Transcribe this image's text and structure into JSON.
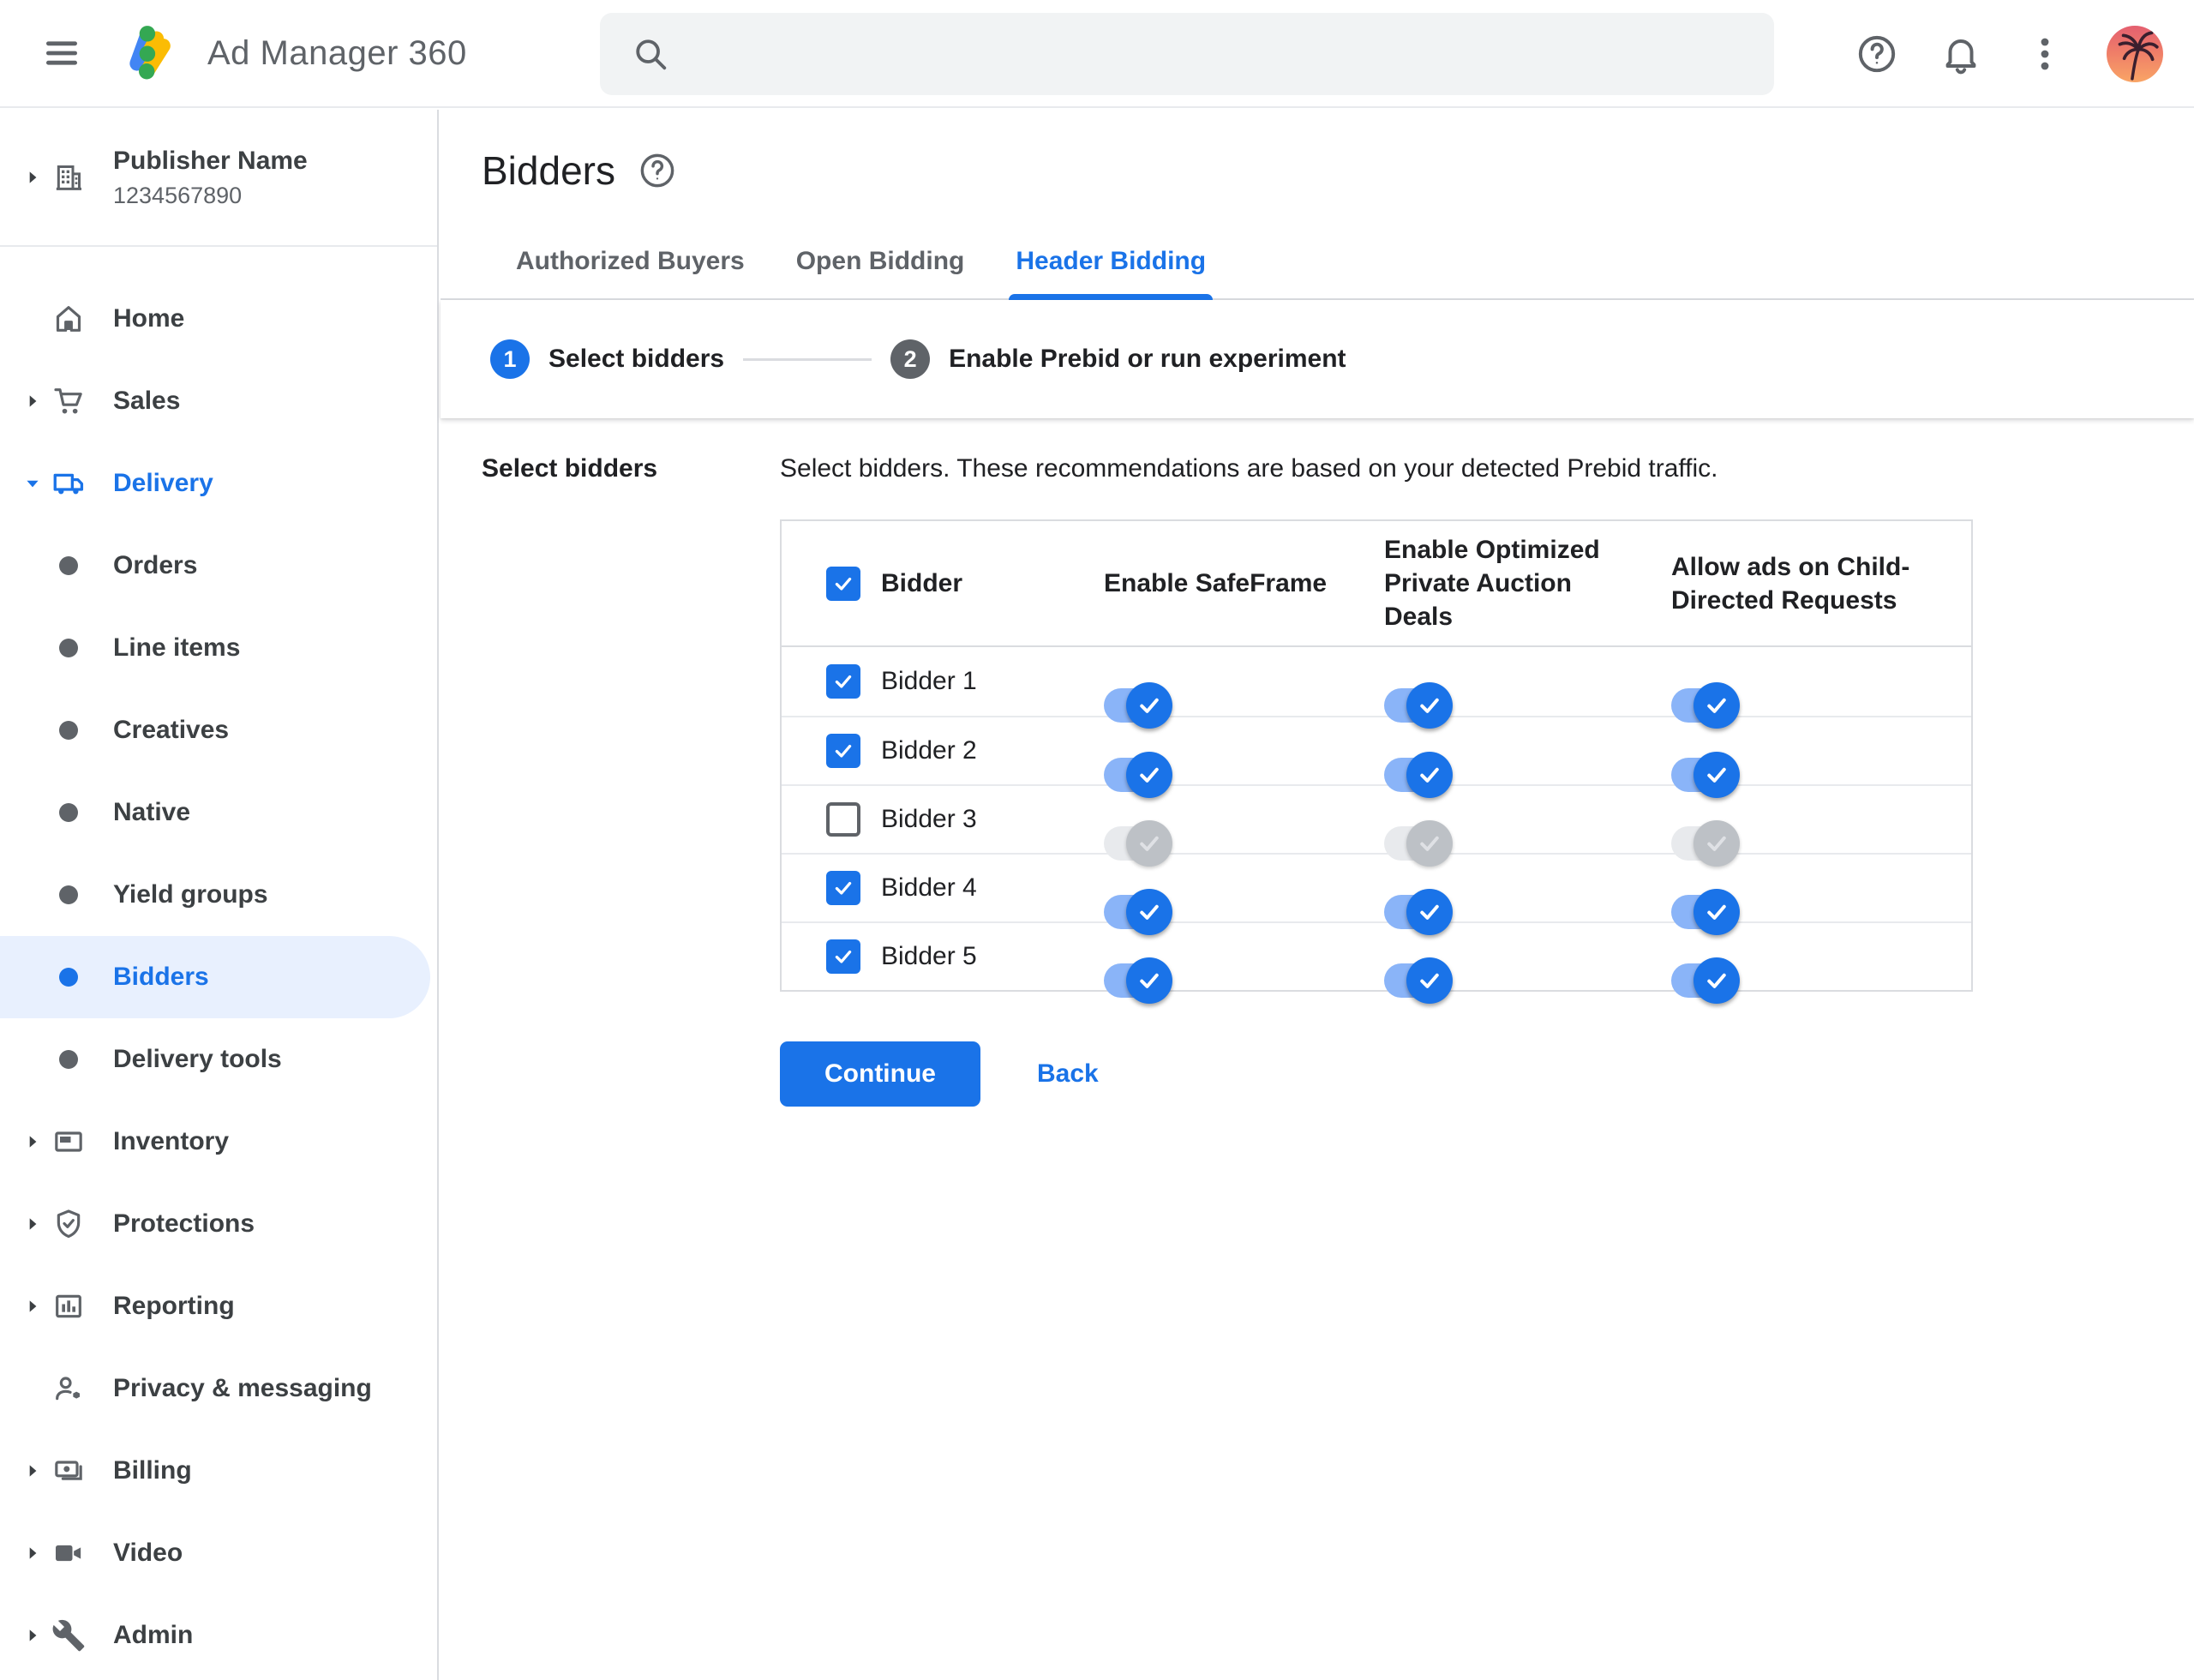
{
  "topbar": {
    "app_name": "Ad Manager 360",
    "search": {
      "value": "",
      "placeholder": ""
    },
    "icons": {
      "menu": "hamburger-icon",
      "logo": "ad-manager-logo",
      "search": "search-icon",
      "help": "help-circle-icon",
      "notifications": "bell-icon",
      "more": "kebab-menu-icon",
      "avatar": "palm-tree-sunset-avatar"
    }
  },
  "sidebar": {
    "publisher": {
      "name": "Publisher Name",
      "id": "1234567890"
    },
    "items": [
      {
        "label": "Home",
        "type": "top",
        "icon": "home-icon",
        "active": false
      },
      {
        "label": "Sales",
        "type": "top",
        "icon": "cart-icon",
        "active": false
      },
      {
        "label": "Delivery",
        "type": "top",
        "icon": "truck-icon",
        "active": true,
        "expanded": true
      },
      {
        "label": "Orders",
        "type": "sub",
        "icon": "bullet",
        "active": false
      },
      {
        "label": "Line items",
        "type": "sub",
        "icon": "bullet",
        "active": false
      },
      {
        "label": "Creatives",
        "type": "sub",
        "icon": "bullet",
        "active": false
      },
      {
        "label": "Native",
        "type": "sub",
        "icon": "bullet",
        "active": false
      },
      {
        "label": "Yield groups",
        "type": "sub",
        "icon": "bullet",
        "active": false
      },
      {
        "label": "Bidders",
        "type": "sub",
        "icon": "bullet",
        "active": true
      },
      {
        "label": "Delivery tools",
        "type": "sub",
        "icon": "bullet",
        "active": false
      },
      {
        "label": "Inventory",
        "type": "top",
        "icon": "ad-unit-icon",
        "active": false
      },
      {
        "label": "Protections",
        "type": "top",
        "icon": "shield-check-icon",
        "active": false
      },
      {
        "label": "Reporting",
        "type": "top",
        "icon": "bar-chart-icon",
        "active": false
      },
      {
        "label": "Privacy & messaging",
        "type": "top",
        "icon": "person-badge-icon",
        "active": false
      },
      {
        "label": "Billing",
        "type": "top",
        "icon": "money-bill-icon",
        "active": false
      },
      {
        "label": "Video",
        "type": "top",
        "icon": "video-camera-icon",
        "active": false
      },
      {
        "label": "Admin",
        "type": "top",
        "icon": "wrench-icon",
        "active": false
      }
    ]
  },
  "main": {
    "title": "Bidders",
    "title_help_icon": "help-circle-icon",
    "tabs": [
      {
        "label": "Authorized Buyers",
        "active": false
      },
      {
        "label": "Open Bidding",
        "active": false
      },
      {
        "label": "Header Bidding",
        "active": true
      }
    ],
    "stepper": [
      {
        "number": "1",
        "label": "Select bidders",
        "active": true
      },
      {
        "number": "2",
        "label": "Enable Prebid or run experiment",
        "active": false
      }
    ],
    "section_label": "Select bidders",
    "description": "Select bidders. These recommendations are based on your detected Prebid traffic.",
    "table": {
      "header_checkbox_checked": true,
      "headers": [
        "Bidder",
        "Enable SafeFrame",
        "Enable Optimized Private Auction Deals",
        "Allow ads on Child-Directed Requests"
      ],
      "rows": [
        {
          "label": "Bidder 1",
          "checked": true,
          "safeframe": true,
          "optimized": true,
          "child_directed": true
        },
        {
          "label": "Bidder 2",
          "checked": true,
          "safeframe": true,
          "optimized": true,
          "child_directed": true
        },
        {
          "label": "Bidder 3",
          "checked": false,
          "safeframe": false,
          "optimized": false,
          "child_directed": false
        },
        {
          "label": "Bidder 4",
          "checked": true,
          "safeframe": true,
          "optimized": true,
          "child_directed": true
        },
        {
          "label": "Bidder 5",
          "checked": true,
          "safeframe": true,
          "optimized": true,
          "child_directed": true
        }
      ]
    },
    "actions": {
      "continue_label": "Continue",
      "back_label": "Back"
    }
  },
  "colors": {
    "accent_blue": "#1a73e8",
    "selected_item_bg": "#e8f0fe",
    "toggle_track_on": "#8ab4f8",
    "toggle_track_off": "#e8eaed",
    "toggle_thumb_off": "#bdc1c6",
    "text_dark": "#202124",
    "text_gray": "#5f6368",
    "divider": "#dadce0",
    "search_bg": "#f1f3f4",
    "logo_blue": "#4285f4",
    "logo_yellow": "#fbbc04",
    "logo_green": "#34a853"
  }
}
